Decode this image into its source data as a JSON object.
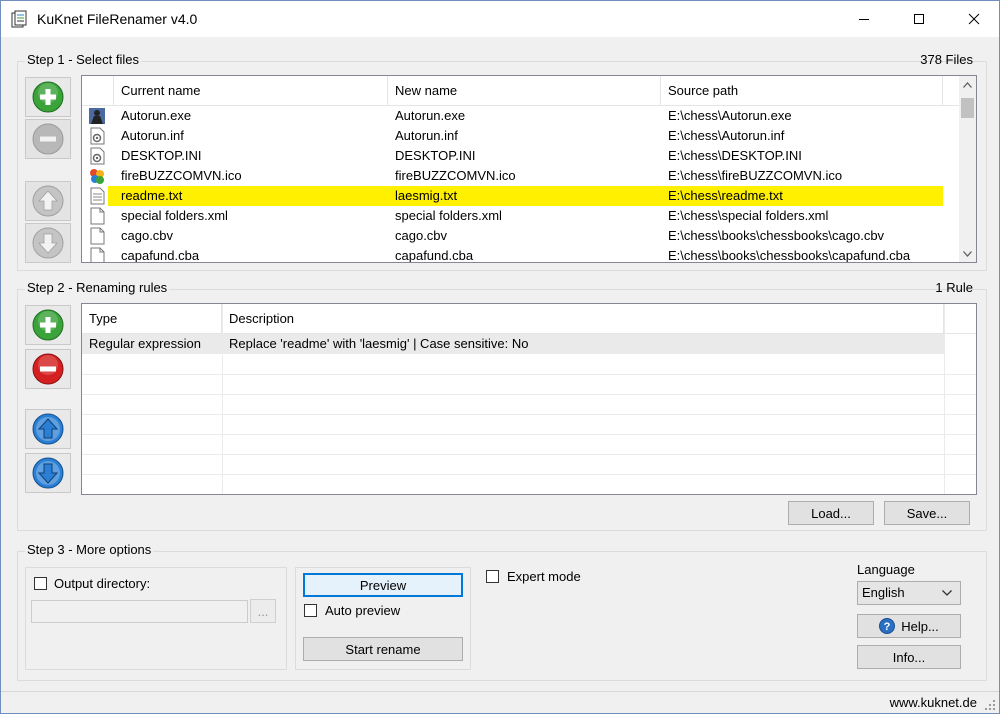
{
  "window": {
    "title": "KuKnet FileRenamer v4.0"
  },
  "step1": {
    "label": "Step 1 - Select files",
    "count": "378 Files",
    "columns": [
      "Current name",
      "New name",
      "Source path"
    ],
    "rows": [
      {
        "icon": "app-exe-icon",
        "current": "Autorun.exe",
        "new": "Autorun.exe",
        "path": "E:\\chess\\Autorun.exe",
        "highlight": false
      },
      {
        "icon": "settings-file-icon",
        "current": "Autorun.inf",
        "new": "Autorun.inf",
        "path": "E:\\chess\\Autorun.inf",
        "highlight": false
      },
      {
        "icon": "settings-file-icon",
        "current": "DESKTOP.INI",
        "new": "DESKTOP.INI",
        "path": "E:\\chess\\DESKTOP.INI",
        "highlight": false
      },
      {
        "icon": "colorful-ico-icon",
        "current": "fireBUZZCOMVN.ico",
        "new": "fireBUZZCOMVN.ico",
        "path": "E:\\chess\\fireBUZZCOMVN.ico",
        "highlight": false
      },
      {
        "icon": "text-file-icon",
        "current": "readme.txt",
        "new": "laesmig.txt",
        "path": "E:\\chess\\readme.txt",
        "highlight": true
      },
      {
        "icon": "blank-file-icon",
        "current": "special folders.xml",
        "new": "special folders.xml",
        "path": "E:\\chess\\special folders.xml",
        "highlight": false
      },
      {
        "icon": "blank-file-icon",
        "current": "cago.cbv",
        "new": "cago.cbv",
        "path": "E:\\chess\\books\\chessbooks\\cago.cbv",
        "highlight": false
      },
      {
        "icon": "blank-file-icon",
        "current": "capafund.cba",
        "new": "capafund.cba",
        "path": "E:\\chess\\books\\chessbooks\\capafund.cba",
        "highlight": false
      }
    ]
  },
  "step2": {
    "label": "Step 2 - Renaming rules",
    "count": "1 Rule",
    "columns": [
      "Type",
      "Description"
    ],
    "rows": [
      {
        "type": "Regular expression",
        "description": "Replace 'readme' with 'laesmig' | Case sensitive: No"
      }
    ],
    "load_label": "Load...",
    "save_label": "Save..."
  },
  "step3": {
    "label": "Step 3 - More options",
    "output_directory_label": "Output directory:",
    "output_directory_value": "",
    "browse_label": "...",
    "preview_label": "Preview",
    "auto_preview_label": "Auto preview",
    "start_rename_label": "Start rename",
    "expert_mode_label": "Expert mode",
    "language_label": "Language",
    "language_value": "English",
    "help_label": "Help...",
    "info_label": "Info..."
  },
  "status": {
    "website": "www.kuknet.de"
  },
  "colors": {
    "highlight_row": "#fff000",
    "add_green": "#3aa33a",
    "remove_red": "#d42020",
    "arrow_blue": "#2a7fd4"
  }
}
